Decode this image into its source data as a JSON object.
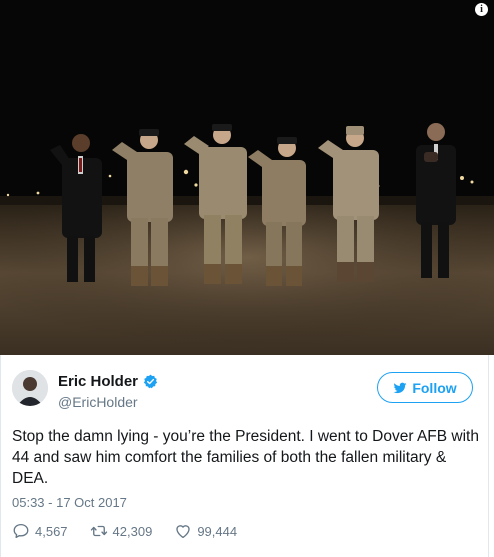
{
  "tweet": {
    "author_name": "Eric Holder",
    "author_handle": "@EricHolder",
    "verified": true,
    "follow_label": "Follow",
    "text": "Stop the damn lying - you’re the President. I went to Dover AFB with 44 and saw him comfort the families of both the fallen military & DEA.",
    "timestamp": "05:33 - 17 Oct 2017",
    "replies": "4,567",
    "retweets": "42,309",
    "likes": "99,444"
  },
  "colors": {
    "accent": "#1da1f2",
    "text": "#14171a",
    "muted": "#657786"
  },
  "icons": {
    "info": "info-icon",
    "verified": "verified-badge-icon",
    "follow": "twitter-bird-icon",
    "reply": "reply-icon",
    "retweet": "retweet-icon",
    "like": "heart-icon"
  }
}
